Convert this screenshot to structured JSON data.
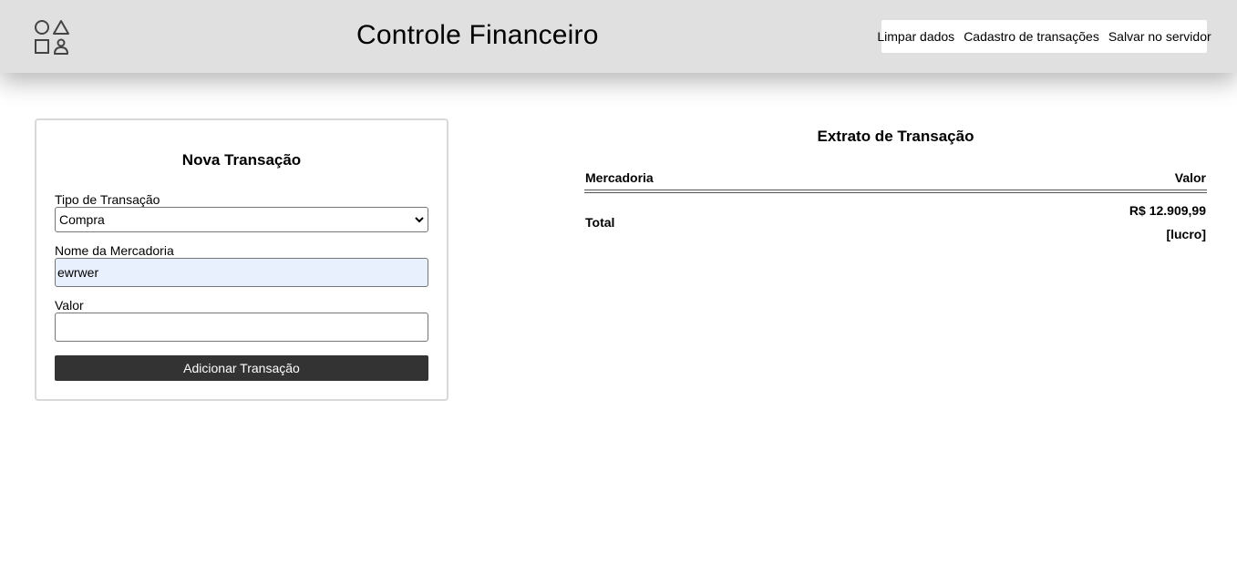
{
  "header": {
    "title": "Controle Financeiro",
    "logo_icon": "shapes-icon",
    "menu": [
      {
        "label": "Limpar dados"
      },
      {
        "label": "Cadastro de transações"
      },
      {
        "label": "Salvar no servidor"
      }
    ]
  },
  "form": {
    "title": "Nova Transação",
    "type_label": "Tipo de Transação",
    "type_value": "Compra",
    "name_label": "Nome da Mercadoria",
    "name_value": "ewrwer",
    "value_label": "Valor",
    "value_value": "",
    "submit_label": "Adicionar Transação"
  },
  "statement": {
    "title": "Extrato de Transação",
    "columns": [
      "Mercadoria",
      "Valor"
    ],
    "total_label": "Total",
    "total_value": "R$ 12.909,99",
    "total_status": "[lucro]"
  },
  "colors": {
    "header_bg": "#e0e0e0",
    "button_bg": "#333333",
    "autofill_bg": "#e8f0fe"
  }
}
